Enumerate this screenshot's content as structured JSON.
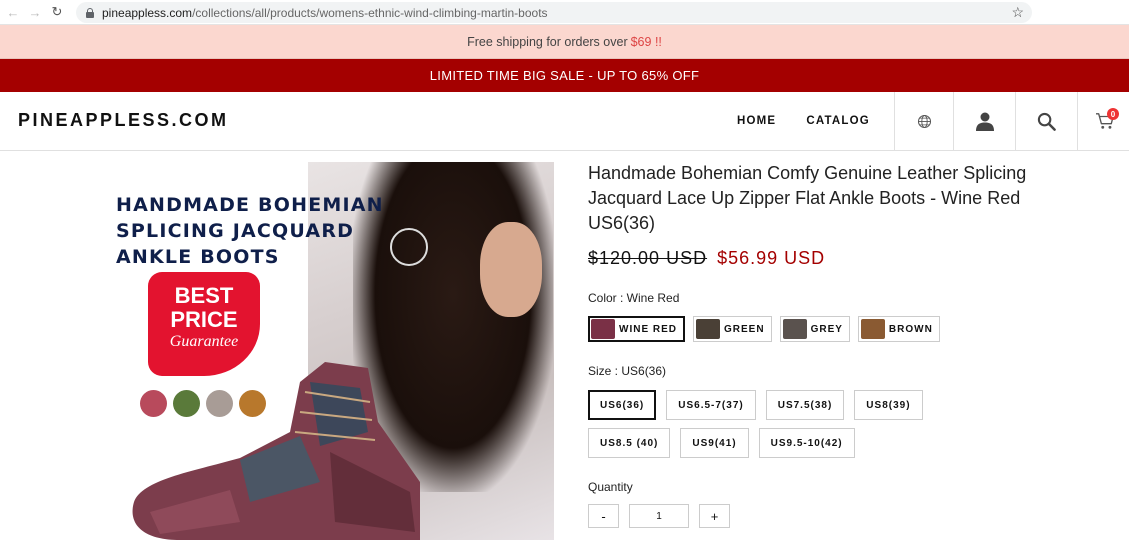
{
  "browser": {
    "url_domain": "pineappless.com",
    "url_path": "/collections/all/products/womens-ethnic-wind-climbing-martin-boots"
  },
  "promo": {
    "text": "Free shipping for orders over",
    "amount": "$69 !!"
  },
  "sale_banner": "LIMITED TIME BIG SALE - UP TO 65% OFF",
  "header": {
    "logo": "PINEAPPLESS.COM",
    "nav": [
      "HOME",
      "CATALOG"
    ],
    "cart_count": "0",
    "icons": [
      "globe-icon",
      "user-icon",
      "search-icon",
      "cart-icon"
    ]
  },
  "gallery": {
    "headline_lines": [
      "HANDMADE BOHEMIAN",
      "SPLICING JACQUARD",
      "ANKLE BOOTS"
    ],
    "badge": [
      "BEST",
      "PRICE",
      "Guarantee"
    ],
    "dot_colors": [
      "#b84a5c",
      "#5a7a3a",
      "#a89c96",
      "#b8782c"
    ]
  },
  "product": {
    "title": "Handmade Bohemian Comfy Genuine Leather Splicing Jacquard Lace Up Zipper Flat Ankle Boots - Wine Red US6(36)",
    "compare_price": "$120.00 USD",
    "price": "$56.99 USD",
    "color_label": "Color : Wine Red",
    "colors": [
      {
        "label": "WINE RED",
        "thumb": "#7a3046",
        "selected": true
      },
      {
        "label": "GREEN",
        "thumb": "#4a4036",
        "selected": false
      },
      {
        "label": "GREY",
        "thumb": "#5a524e",
        "selected": false
      },
      {
        "label": "BROWN",
        "thumb": "#8a5a32",
        "selected": false
      }
    ],
    "size_label": "Size : US6(36)",
    "sizes": [
      {
        "label": "US6(36)",
        "selected": true
      },
      {
        "label": "US6.5-7(37)",
        "selected": false
      },
      {
        "label": "US7.5(38)",
        "selected": false
      },
      {
        "label": "US8(39)",
        "selected": false
      },
      {
        "label": "US8.5 (40)",
        "selected": false
      },
      {
        "label": "US9(41)",
        "selected": false
      },
      {
        "label": "US9.5-10(42)",
        "selected": false
      }
    ],
    "quantity_label": "Quantity",
    "quantity": "1",
    "minus": "-",
    "plus": "+"
  },
  "colors": {
    "sale_red": "#a40000",
    "promo_bg": "#fbd7cf"
  }
}
